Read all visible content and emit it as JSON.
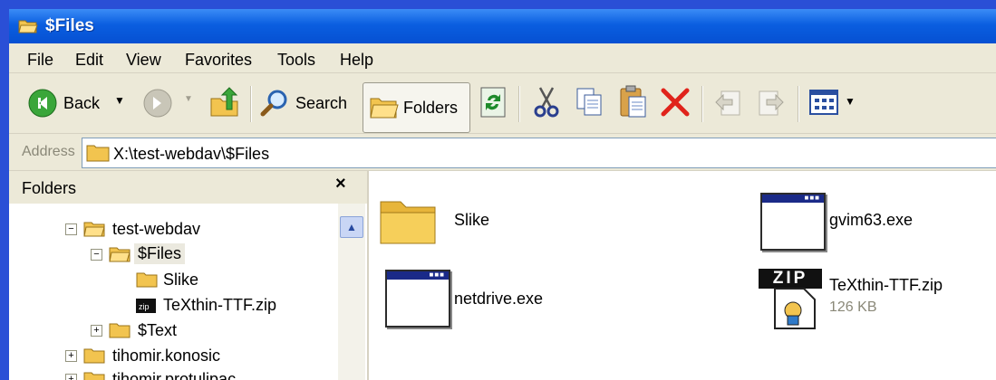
{
  "window": {
    "title": "$Files"
  },
  "menu": [
    "File",
    "Edit",
    "View",
    "Favorites",
    "Tools",
    "Help"
  ],
  "toolbar": {
    "back": "Back",
    "search": "Search",
    "folders": "Folders"
  },
  "address": {
    "label": "Address",
    "value": "X:\\test-webdav\\$Files"
  },
  "folders_panel": {
    "title": "Folders",
    "close": "×",
    "items": [
      {
        "label": "test-webdav",
        "expander": "−"
      },
      {
        "label": "$Files",
        "expander": "−"
      },
      {
        "label": "Slike",
        "expander": ""
      },
      {
        "label": "TeXthin-TTF.zip",
        "expander": ""
      },
      {
        "label": "$Text",
        "expander": "+"
      },
      {
        "label": "tihomir.konosic",
        "expander": "+"
      },
      {
        "label": "tihomir.protulipac",
        "expander": "+"
      }
    ]
  },
  "files": [
    {
      "name": "Slike",
      "type": "folder"
    },
    {
      "name": "gvim63.exe",
      "type": "exe"
    },
    {
      "name": "netdrive.exe",
      "type": "exe"
    },
    {
      "name": "TeXthin-TTF.zip",
      "type": "zip",
      "size": "126 KB",
      "badge": "ZIP"
    }
  ],
  "colors": {
    "titlebar": "#0a5ee0",
    "delete": "#e0231b",
    "desktop": "#2a4fd6"
  }
}
